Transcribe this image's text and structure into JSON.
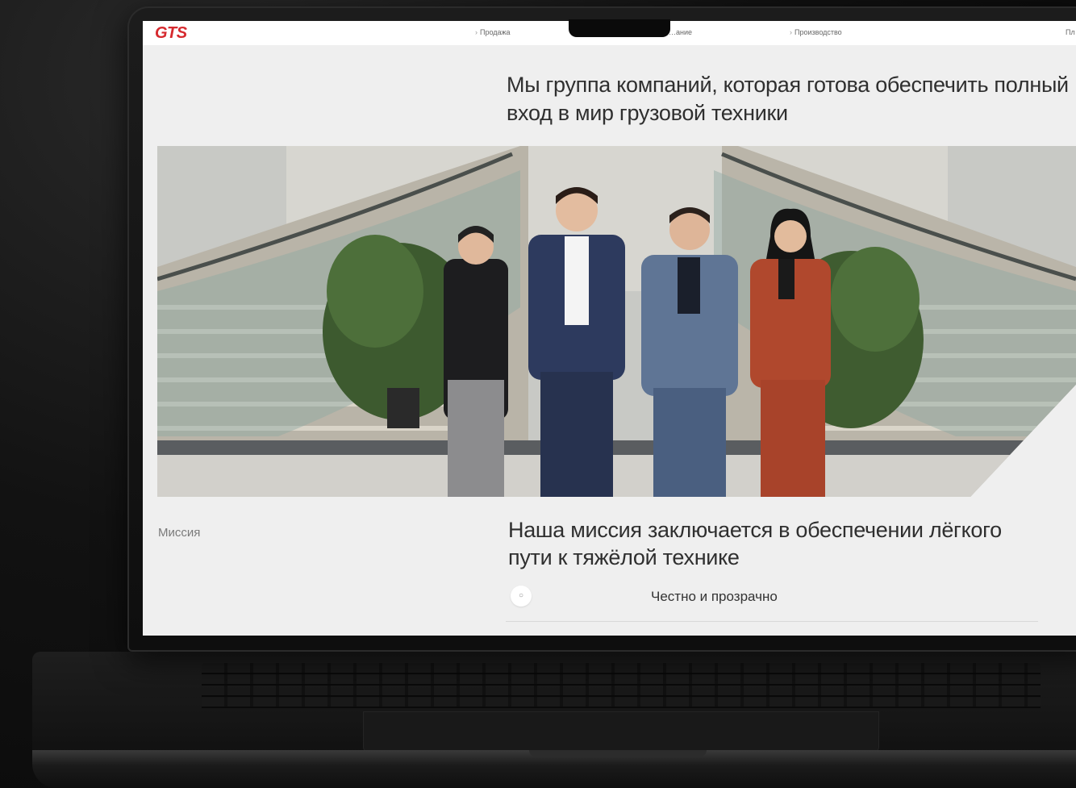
{
  "nav": {
    "logo": "GTS",
    "links": [
      "Продажа",
      "…ание",
      "Производство"
    ],
    "edge_fragment": "Пл"
  },
  "hero": {
    "headline": "Мы группа компаний, которая готова обеспечить полный вход в мир грузовой техники"
  },
  "mission": {
    "label": "Миссия",
    "text": "Наша миссия заключается в обеспечении лёгкого пути к тяжёлой технике",
    "values": [
      {
        "icon": "circle-icon",
        "label": "Честно и прозрачно"
      }
    ]
  },
  "colors": {
    "brand_red": "#d62a2f",
    "page_bg": "#efefef",
    "text": "#2f2f2f"
  }
}
